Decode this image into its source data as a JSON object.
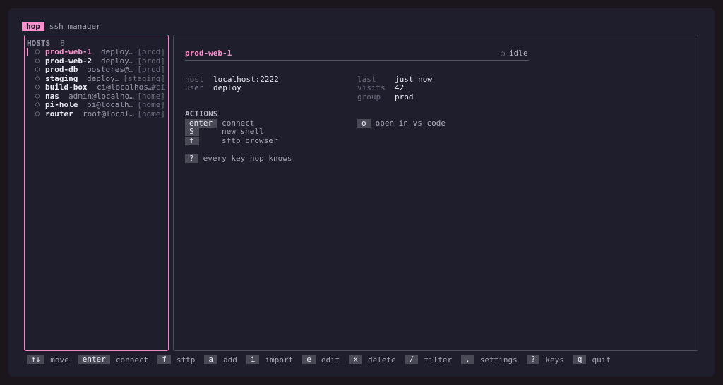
{
  "app": {
    "name": "hop",
    "subtitle": "ssh manager"
  },
  "hosts_panel": {
    "label": "HOSTS",
    "count": "8",
    "items": [
      {
        "name": "prod-web-1",
        "detail": "deploy…",
        "tag": "[prod]",
        "selected": true
      },
      {
        "name": "prod-web-2",
        "detail": "deploy…",
        "tag": "[prod]"
      },
      {
        "name": "prod-db",
        "detail": "postgres@…",
        "tag": "[prod]"
      },
      {
        "name": "staging",
        "detail": "deploy…",
        "tag": "[staging]"
      },
      {
        "name": "build-box",
        "detail": "ci@localhos…",
        "tag": "#ci"
      },
      {
        "name": "nas",
        "detail": "admin@localho…",
        "tag": "[home]"
      },
      {
        "name": "pi-hole",
        "detail": "pi@localh…",
        "tag": "[home]"
      },
      {
        "name": "router",
        "detail": "root@local…",
        "tag": "[home]"
      }
    ]
  },
  "detail": {
    "title": "prod-web-1",
    "status": "idle",
    "host_label": "host",
    "host_value": "localhost:2222",
    "user_label": "user",
    "user_value": "deploy",
    "last_label": "last",
    "last_value": "just now",
    "visits_label": "visits",
    "visits_value": "42",
    "group_label": "group",
    "group_value": "prod",
    "actions_title": "ACTIONS",
    "actions": {
      "connect_key": "enter",
      "connect_label": "connect",
      "shell_key": "S",
      "shell_label": "new shell",
      "sftp_key": "f",
      "sftp_label": "sftp browser",
      "vscode_key": "o",
      "vscode_label": "open in vs code",
      "help_key": "?",
      "help_label": "every key hop knows"
    }
  },
  "footer": [
    {
      "key": "↑↓",
      "label": "move"
    },
    {
      "key": "enter",
      "label": "connect"
    },
    {
      "key": "f",
      "label": "sftp"
    },
    {
      "key": "a",
      "label": "add"
    },
    {
      "key": "i",
      "label": "import"
    },
    {
      "key": "e",
      "label": "edit"
    },
    {
      "key": "x",
      "label": "delete"
    },
    {
      "key": "/",
      "label": "filter"
    },
    {
      "key": ",",
      "label": "settings"
    },
    {
      "key": "?",
      "label": "keys"
    },
    {
      "key": "q",
      "label": "quit"
    }
  ],
  "colors": {
    "accent": "#f68fcb",
    "panel_bg": "#1f1e2c",
    "page_bg": "#1b161c"
  },
  "icons": {
    "status": "status-circle-icon",
    "host": "host-status-dot-icon"
  }
}
